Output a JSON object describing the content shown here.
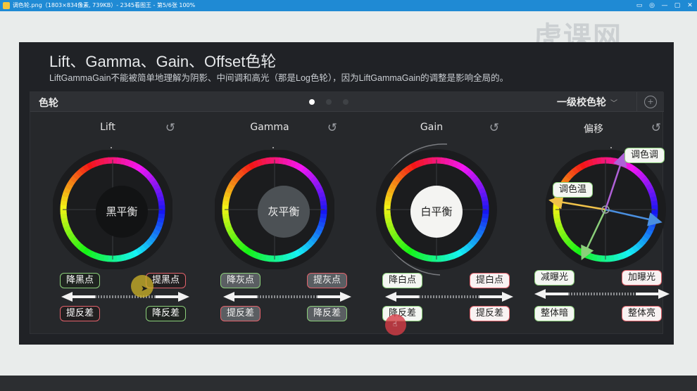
{
  "viewer": {
    "title": "调色轮.png（1803×834像素, 739KB）- 2345看图王 - 第5/6张 100%",
    "icon": "image-viewer-icon",
    "controls": [
      "pin-icon",
      "skin-icon",
      "minimize-icon",
      "maximize-icon",
      "close-icon"
    ]
  },
  "watermark": "虎课网",
  "slide": {
    "title": "Lift、Gamma、Gain、Offset色轮",
    "subtitle": "LiftGammaGain不能被简单地理解为阴影、中间调和高光（那是Log色轮），因为LiftGammaGain的调整是影响全局的。"
  },
  "panel": {
    "title": "色轮",
    "mode": "一级校色轮",
    "page_count": 3,
    "active_page": 1
  },
  "wheels": [
    {
      "label": "Lift",
      "center": "黑平衡",
      "top_left": "降黑点",
      "top_right": "提黑点",
      "bottom_left": "提反差",
      "bottom_right": "降反差"
    },
    {
      "label": "Gamma",
      "center": "灰平衡",
      "top_left": "降灰点",
      "top_right": "提灰点",
      "bottom_left": "提反差",
      "bottom_right": "降反差"
    },
    {
      "label": "Gain",
      "center": "白平衡",
      "top_left": "降白点",
      "top_right": "提白点",
      "bottom_left": "降反差",
      "bottom_right": "提反差"
    },
    {
      "label": "偏移",
      "center": "",
      "tint_label": "调色调",
      "temp_label": "调色温",
      "top_left": "减曝光",
      "top_right": "加曝光",
      "bottom_left": "整体暗",
      "bottom_right": "整体亮"
    }
  ],
  "colors": {
    "accent_green": "#8bcf7a",
    "accent_red": "#e2626b",
    "titlebar": "#1f8ad4"
  }
}
